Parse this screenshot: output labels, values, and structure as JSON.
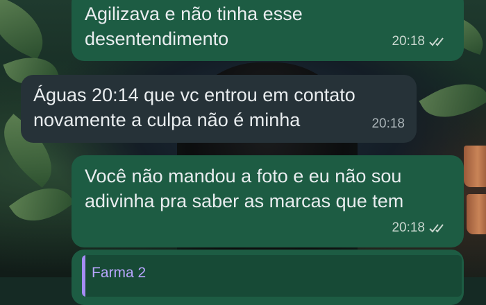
{
  "chat": {
    "messages": [
      {
        "direction": "outgoing",
        "text": "Agilizava e não tinha esse\ndesentendimento",
        "time": "20:18",
        "status": "read"
      },
      {
        "direction": "incoming",
        "text": "Águas 20:14 que vc entrou em contato\nnovamente a culpa não é minha",
        "time": "20:18"
      },
      {
        "direction": "outgoing",
        "text": "Você não mandou a foto e eu não sou\nadivinha pra saber as marcas que tem",
        "time": "20:18",
        "status": "read"
      }
    ],
    "partial_message": {
      "direction": "outgoing",
      "quoted_sender": "Farma 2"
    }
  },
  "icons": {
    "read_receipt": "double-check-icon"
  },
  "colors": {
    "outgoing_bubble": "#1d5c43",
    "incoming_bubble": "#263238",
    "text": "#e9edef",
    "quote_accent": "#a58cf5",
    "quote_name": "#b9a6ff",
    "meta": "#c9d7cf"
  }
}
